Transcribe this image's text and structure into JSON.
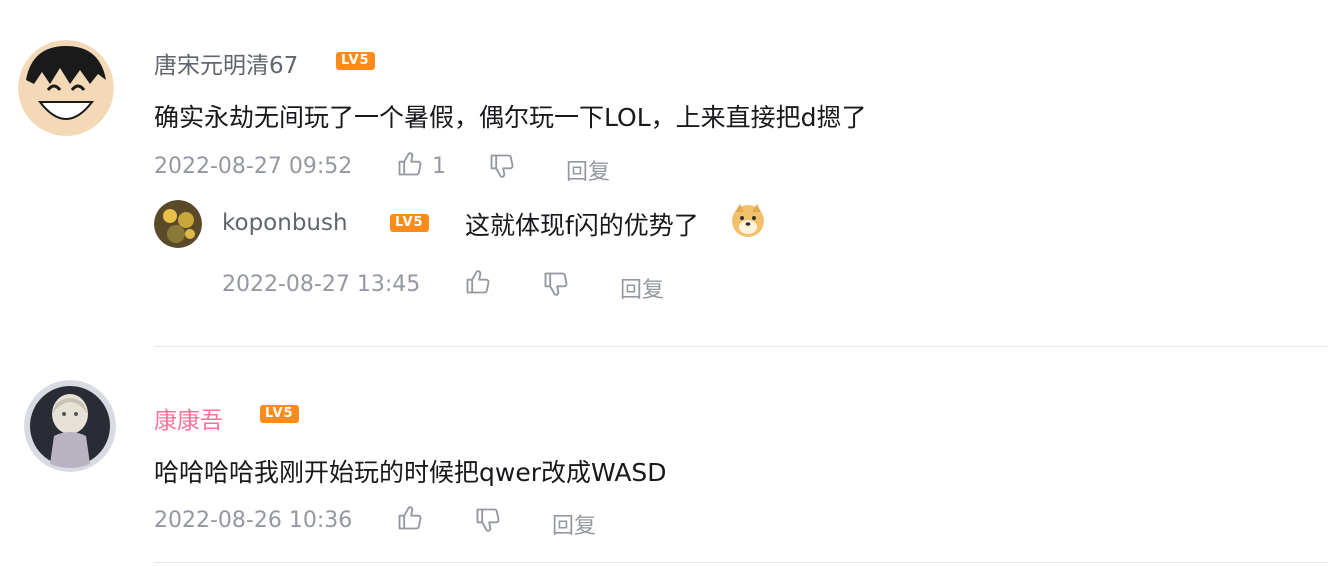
{
  "comments": [
    {
      "username": "唐宋元明清67",
      "level": "LV5",
      "content": "确实永劫无间玩了一个暑假，偶尔玩一下LOL，上来直接把d摁了",
      "timestamp": "2022-08-27 09:52",
      "like_count": "1",
      "reply_label": "回复",
      "replies": [
        {
          "username": "koponbush",
          "level": "LV5",
          "content": "这就体现f闪的优势了",
          "emoji": "doge-emoji",
          "timestamp": "2022-08-27 13:45",
          "reply_label": "回复"
        }
      ]
    },
    {
      "username": "康康吾",
      "level": "LV5",
      "content": "哈哈哈哈我刚开始玩的时候把qwer改成WASD",
      "timestamp": "2022-08-26 10:36",
      "reply_label": "回复"
    }
  ],
  "colors": {
    "username_default": "#61666d",
    "username_vip": "#fb7299",
    "level_badge": "#ff8c1a",
    "meta": "#9499a0",
    "divider": "#e3e5e7"
  }
}
